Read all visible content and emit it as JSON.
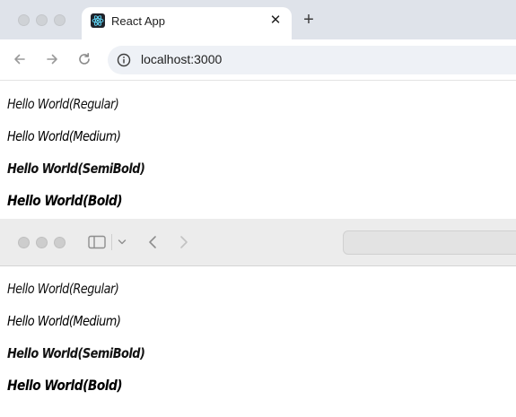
{
  "chrome": {
    "tab_title": "React App",
    "tab_close": "✕",
    "new_tab": "+",
    "url": "localhost:3000",
    "lines": [
      "Hello World(Regular)",
      "Hello World(Medium)",
      "Hello World(SemiBold)",
      "Hello World(Bold)"
    ]
  },
  "safari": {
    "lines": [
      "Hello World(Regular)",
      "Hello World(Medium)",
      "Hello World(SemiBold)",
      "Hello World(Bold)"
    ]
  },
  "icons": {
    "favicon": "react-logo-icon",
    "back": "arrow-left-icon",
    "forward": "arrow-right-icon",
    "reload": "reload-icon",
    "site_info": "info-icon",
    "sidebar": "sidebar-icon",
    "chevron": "chevron-down-icon"
  }
}
